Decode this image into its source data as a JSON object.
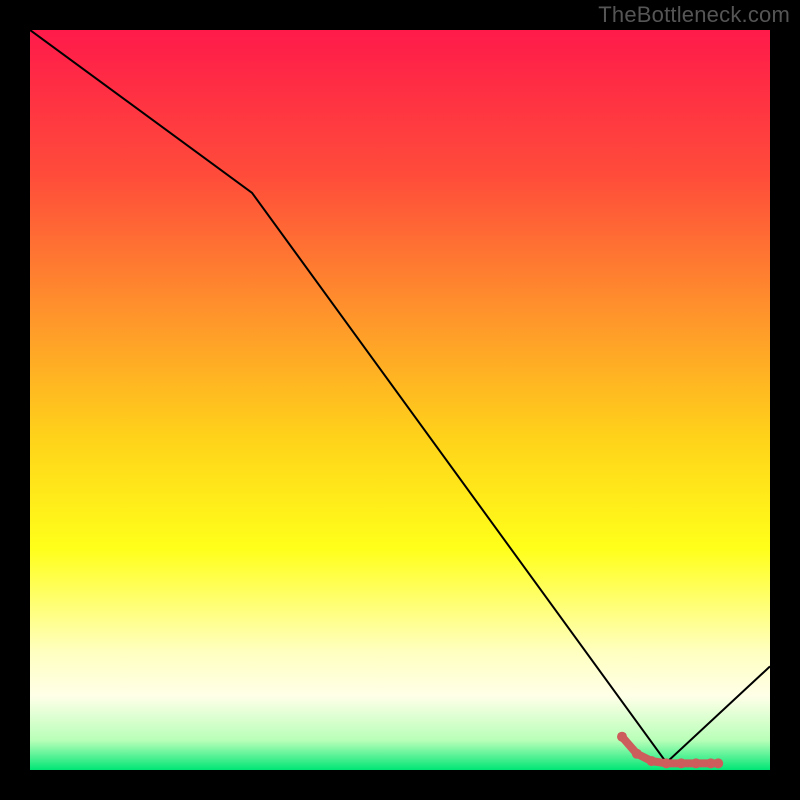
{
  "watermark": "TheBottleneck.com",
  "chart_data": {
    "type": "line",
    "title": "",
    "xlabel": "",
    "ylabel": "",
    "xlim": [
      0,
      100
    ],
    "ylim": [
      0,
      100
    ],
    "grid": false,
    "series": [
      {
        "name": "black-line",
        "color": "#000000",
        "x": [
          0,
          30,
          86,
          100
        ],
        "y": [
          100,
          78,
          1,
          14
        ]
      },
      {
        "name": "red-accent",
        "color": "#cd5c5c",
        "x": [
          80,
          82,
          84,
          86,
          88,
          90,
          92,
          93
        ],
        "y": [
          4.5,
          2.2,
          1.2,
          0.9,
          0.9,
          0.9,
          0.9,
          0.9
        ]
      }
    ],
    "background_gradient": {
      "stops": [
        {
          "offset": 0.0,
          "color": "#ff1a4a"
        },
        {
          "offset": 0.2,
          "color": "#ff4d3a"
        },
        {
          "offset": 0.4,
          "color": "#ff9a2a"
        },
        {
          "offset": 0.55,
          "color": "#ffd21a"
        },
        {
          "offset": 0.7,
          "color": "#ffff1a"
        },
        {
          "offset": 0.84,
          "color": "#ffffc0"
        },
        {
          "offset": 0.9,
          "color": "#ffffe8"
        },
        {
          "offset": 0.96,
          "color": "#b8ffb8"
        },
        {
          "offset": 1.0,
          "color": "#00e676"
        }
      ]
    }
  }
}
